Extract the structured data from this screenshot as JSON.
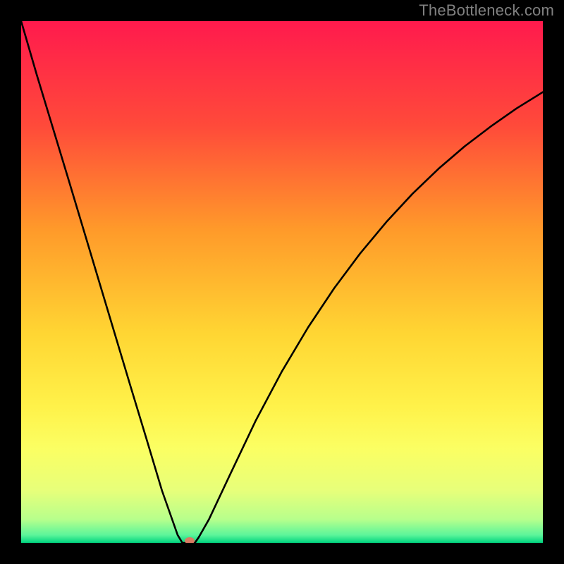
{
  "watermark": "TheBottleneck.com",
  "chart_data": {
    "type": "line",
    "title": "",
    "xlabel": "",
    "ylabel": "",
    "xlim": [
      0,
      100
    ],
    "ylim": [
      0,
      100
    ],
    "background_gradient_stops": [
      {
        "offset": 0,
        "color": "#ff1a4d"
      },
      {
        "offset": 0.2,
        "color": "#ff4a3a"
      },
      {
        "offset": 0.4,
        "color": "#ff9a2a"
      },
      {
        "offset": 0.6,
        "color": "#ffd633"
      },
      {
        "offset": 0.74,
        "color": "#fff24a"
      },
      {
        "offset": 0.82,
        "color": "#fbff63"
      },
      {
        "offset": 0.9,
        "color": "#e7ff7a"
      },
      {
        "offset": 0.955,
        "color": "#b7ff8c"
      },
      {
        "offset": 0.985,
        "color": "#5cf59a"
      },
      {
        "offset": 1.0,
        "color": "#00d37f"
      }
    ],
    "series": [
      {
        "name": "bottleneck-curve",
        "x": [
          0.0,
          3.0,
          6.0,
          9.0,
          12.0,
          15.0,
          18.0,
          21.0,
          24.0,
          27.0,
          30.0,
          30.9,
          31.4,
          33.3,
          34.0,
          36.0,
          40.0,
          45.0,
          50.0,
          55.0,
          60.0,
          65.0,
          70.0,
          75.0,
          80.0,
          85.0,
          90.0,
          95.0,
          100.0
        ],
        "y": [
          100.0,
          89.7,
          79.8,
          69.9,
          59.9,
          49.9,
          39.9,
          29.9,
          20.0,
          10.0,
          1.5,
          0.0,
          0.0,
          0.0,
          1.0,
          4.5,
          13.0,
          23.5,
          32.9,
          41.3,
          48.8,
          55.5,
          61.5,
          66.9,
          71.7,
          76.0,
          79.8,
          83.3,
          86.4
        ]
      }
    ],
    "marker": {
      "x": 32.3,
      "y": 0.0,
      "color": "#d97b63",
      "rx": 7,
      "ry": 5
    }
  }
}
